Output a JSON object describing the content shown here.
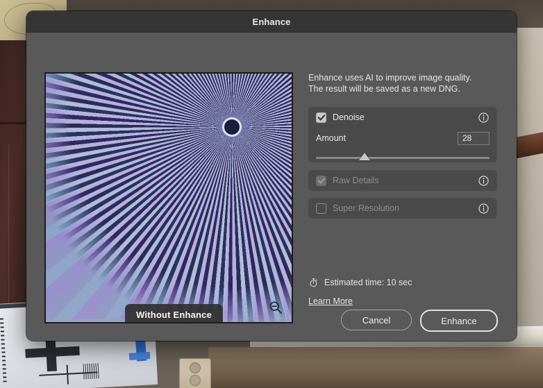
{
  "dialog": {
    "title": "Enhance",
    "intro": "Enhance uses AI to improve image quality. The result will be saved as a new DNG.",
    "options": [
      {
        "id": "denoise",
        "label": "Denoise",
        "checked": true,
        "enabled": true,
        "info_icon": "info-circle-icon",
        "amount": {
          "label": "Amount",
          "value": "28",
          "slider_percent": 28
        }
      },
      {
        "id": "raw-details",
        "label": "Raw Details",
        "checked": true,
        "enabled": false,
        "info_icon": "info-circle-icon"
      },
      {
        "id": "super-resolution",
        "label": "Super Resolution",
        "checked": false,
        "enabled": false,
        "info_icon": "info-circle-icon"
      }
    ],
    "estimated_time": "Estimated time: 10 sec",
    "estimated_time_icon": "stopwatch-icon",
    "learn_more": "Learn More",
    "buttons": {
      "cancel": "Cancel",
      "enhance": "Enhance"
    }
  },
  "preview": {
    "overlay_badge": "Without Enhance",
    "zoom_icon": "magnifier-minus-icon",
    "subject": "radial starburst resolution test chart"
  },
  "colors": {
    "dialog_body": "#595959",
    "titlebar": "#353535",
    "panel": "#4a4a4a",
    "text": "#e8e8e8",
    "disabled_text": "#8e8e8e",
    "checkbox_fill": "#c9c9c9"
  }
}
